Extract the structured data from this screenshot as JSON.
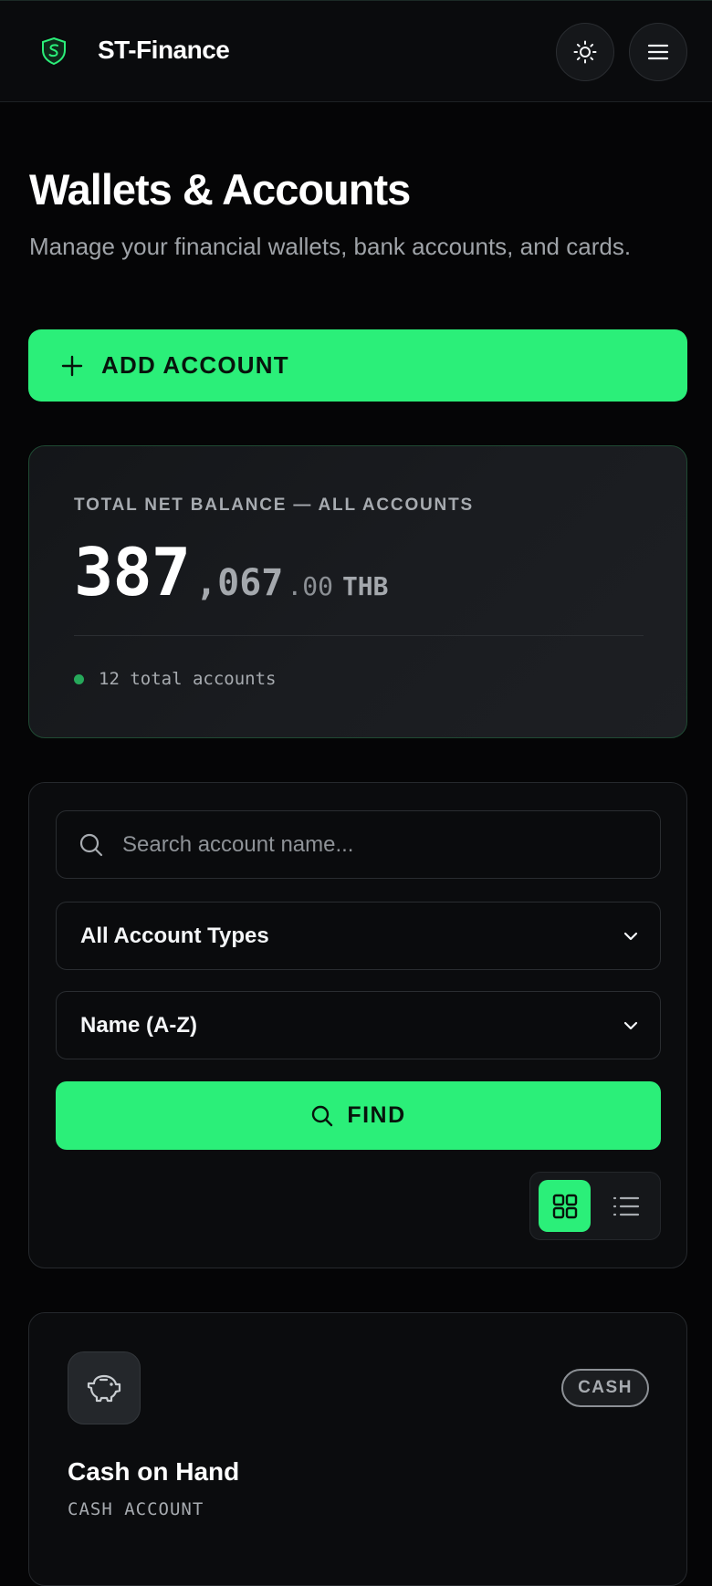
{
  "header": {
    "brand": "ST-Finance",
    "logo_icon": "shield-logo-icon",
    "theme_icon": "sun-icon",
    "menu_icon": "hamburger-icon"
  },
  "page": {
    "title": "Wallets & Accounts",
    "subtitle": "Manage your financial wallets, bank accounts, and cards."
  },
  "add_account": {
    "icon": "plus-icon",
    "label": "ADD ACCOUNT"
  },
  "balance": {
    "label": "TOTAL NET BALANCE — ALL ACCOUNTS",
    "amount_int": "387",
    "amount_thousands": ",067",
    "amount_decimal": ".00",
    "currency": "THB",
    "count_text": "12 total accounts"
  },
  "filters": {
    "search_placeholder": "Search account name...",
    "search_value": "",
    "type_select": "All Account Types",
    "sort_select": "Name (A-Z)",
    "find_label": "FIND",
    "view_mode": "grid"
  },
  "accounts": [
    {
      "icon": "piggy-bank-icon",
      "badge": "CASH",
      "name": "Cash on Hand",
      "type": "CASH ACCOUNT"
    }
  ],
  "colors": {
    "accent": "#2bef79",
    "background": "#050506",
    "card": "#0b0c0e",
    "balance_border": "#1f4a33",
    "muted_text": "#9fa3a8"
  }
}
